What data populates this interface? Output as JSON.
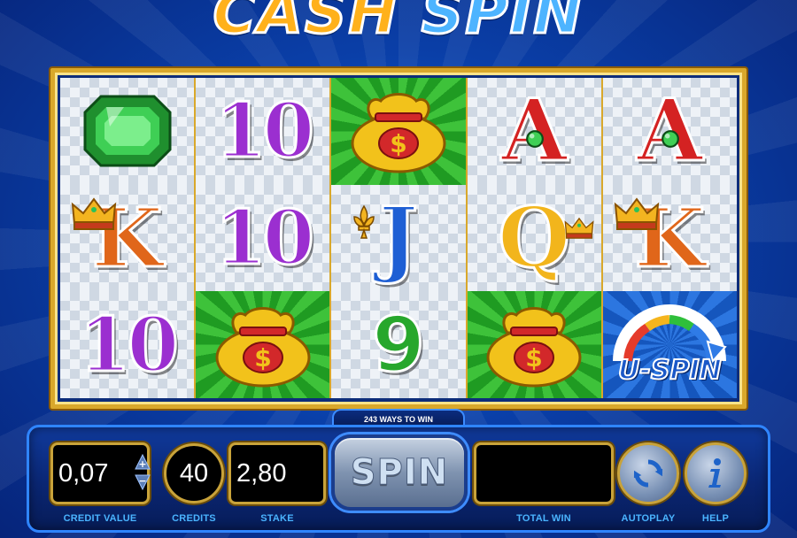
{
  "logo": {
    "word1": "CASH",
    "word2": "SPIN"
  },
  "reels": [
    [
      {
        "symbol": "emerald",
        "bg": "checker"
      },
      {
        "symbol": "K",
        "bg": "checker"
      },
      {
        "symbol": "10",
        "bg": "checker"
      }
    ],
    [
      {
        "symbol": "10",
        "bg": "checker"
      },
      {
        "symbol": "10",
        "bg": "checker"
      },
      {
        "symbol": "money-bag",
        "bg": "green"
      }
    ],
    [
      {
        "symbol": "money-bag",
        "bg": "green"
      },
      {
        "symbol": "J",
        "bg": "checker"
      },
      {
        "symbol": "9",
        "bg": "checker"
      }
    ],
    [
      {
        "symbol": "A",
        "bg": "checker"
      },
      {
        "symbol": "Q",
        "bg": "checker"
      },
      {
        "symbol": "money-bag",
        "bg": "green"
      }
    ],
    [
      {
        "symbol": "A",
        "bg": "checker"
      },
      {
        "symbol": "K",
        "bg": "checker"
      },
      {
        "symbol": "U-SPIN",
        "bg": "blue"
      }
    ]
  ],
  "ways_to_win": "243 WAYS TO WIN",
  "controls": {
    "credit_value": "0,07",
    "credit_value_label": "CREDIT VALUE",
    "credits": "40",
    "credits_label": "CREDITS",
    "stake": "2,80",
    "stake_label": "STAKE",
    "spin_label": "SPIN",
    "total_win": "",
    "total_win_label": "TOTAL WIN",
    "autoplay_label": "AUTOPLAY",
    "help_label": "HELP",
    "stepper_plus": "+",
    "stepper_minus": "−"
  },
  "colors": {
    "background": "#0a3fa8",
    "gold_frame": "#d9a82b",
    "label_blue": "#4ab4ff"
  }
}
